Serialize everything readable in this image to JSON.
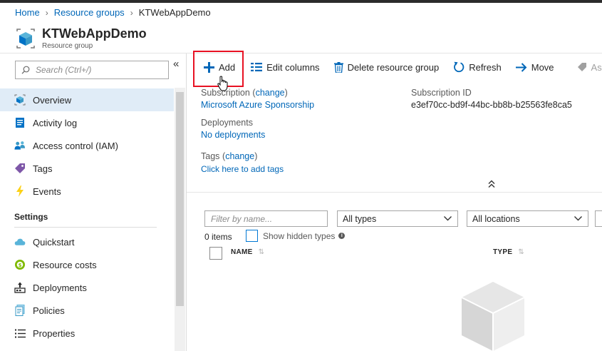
{
  "breadcrumb": {
    "home": "Home",
    "resource_groups": "Resource groups",
    "current": "KTWebAppDemo"
  },
  "header": {
    "title": "KTWebAppDemo",
    "subtitle": "Resource group"
  },
  "sidebar": {
    "search_placeholder": "Search (Ctrl+/)",
    "collapse_glyph": "«",
    "items": [
      {
        "label": "Overview",
        "icon": "overview-cube-icon",
        "active": true
      },
      {
        "label": "Activity log",
        "icon": "activity-log-icon"
      },
      {
        "label": "Access control (IAM)",
        "icon": "people-icon"
      },
      {
        "label": "Tags",
        "icon": "tag-icon"
      },
      {
        "label": "Events",
        "icon": "lightning-icon"
      }
    ],
    "settings_header": "Settings",
    "settings_items": [
      {
        "label": "Quickstart",
        "icon": "cloud-icon"
      },
      {
        "label": "Resource costs",
        "icon": "coin-icon"
      },
      {
        "label": "Deployments",
        "icon": "deploy-icon"
      },
      {
        "label": "Policies",
        "icon": "policy-icon"
      },
      {
        "label": "Properties",
        "icon": "list-icon"
      }
    ]
  },
  "toolbar": {
    "add": "Add",
    "edit_columns": "Edit columns",
    "delete": "Delete resource group",
    "refresh": "Refresh",
    "move": "Move",
    "assign": "Ass"
  },
  "essentials": {
    "subscription_label": "Subscription",
    "change_label": "change",
    "subscription_value": "Microsoft Azure Sponsorship",
    "subscription_id_label": "Subscription ID",
    "subscription_id_value": "e3ef70cc-bd9f-44bc-bb8b-b25563fe8ca5",
    "deployments_label": "Deployments",
    "deployments_value": "No deployments",
    "tags_label": "Tags",
    "tags_change": "change",
    "tags_value": "Click here to add tags",
    "collapse_glyph": "⌃"
  },
  "filters": {
    "name_placeholder": "Filter by name...",
    "types_value": "All types",
    "locations_value": "All locations"
  },
  "list": {
    "count": "0 items",
    "show_hidden": "Show hidden types",
    "col_name": "NAME",
    "col_type": "TYPE"
  },
  "colors": {
    "accent": "#0067b8",
    "highlight": "#e81123",
    "active_bg": "#e0ecf7"
  }
}
